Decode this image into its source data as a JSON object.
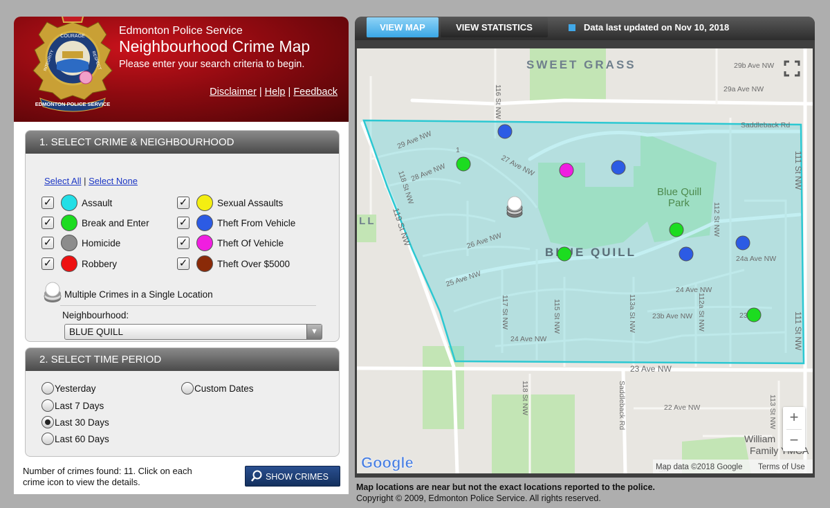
{
  "header": {
    "org": "Edmonton Police Service",
    "title": "Neighbourhood Crime Map",
    "prompt": "Please enter your search criteria to begin.",
    "links": {
      "disclaimer": "Disclaimer",
      "help": "Help",
      "feedback": "Feedback",
      "sep": "|"
    },
    "crest_text": {
      "top": "COURAGE",
      "left": "INTEGRITY",
      "right": "RESPECT",
      "banner": "EDMONTON POLICE SERVICE"
    }
  },
  "section1": {
    "title": "1. SELECT CRIME & NEIGHBOURHOOD",
    "select_all": "Select All",
    "select_none": "Select None",
    "sep": "|",
    "crimes": [
      {
        "label": "Assault",
        "color": "#22dfe6",
        "checked": true
      },
      {
        "label": "Break and Enter",
        "color": "#1cdc20",
        "checked": true
      },
      {
        "label": "Homicide",
        "color": "#8c8c8c",
        "checked": true
      },
      {
        "label": "Robbery",
        "color": "#ee1111",
        "checked": true
      },
      {
        "label": "Sexual Assaults",
        "color": "#f4ee12",
        "checked": true
      },
      {
        "label": "Theft From Vehicle",
        "color": "#2c5be4",
        "checked": true
      },
      {
        "label": "Theft Of Vehicle",
        "color": "#f01ee0",
        "checked": true
      },
      {
        "label": "Theft Over $5000",
        "color": "#8a2a08",
        "checked": true
      }
    ],
    "multi_label": "Multiple Crimes in a Single Location",
    "neighbourhood_label": "Neighbourhood:",
    "neighbourhood_value": "BLUE QUILL"
  },
  "section2": {
    "title": "2. SELECT TIME PERIOD",
    "options": [
      {
        "label": "Yesterday",
        "selected": false
      },
      {
        "label": "Last 7 Days",
        "selected": false
      },
      {
        "label": "Last 30 Days",
        "selected": true
      },
      {
        "label": "Last 60 Days",
        "selected": false
      },
      {
        "label": "Custom Dates",
        "selected": false
      }
    ]
  },
  "results": {
    "count_text": "Number of crimes found: 11. Click on each crime icon to view the details.",
    "show_button": "SHOW CRIMES"
  },
  "tabs": {
    "map": "VIEW MAP",
    "stats": "VIEW STATISTICS"
  },
  "updated_text": "Data last updated on Nov 10, 2018",
  "map": {
    "area_labels": {
      "north": "SWEET GRASS",
      "main": "BLUE QUILL",
      "park_line1": "Blue Quill",
      "park_line2": "Park",
      "west_partial": "ILL"
    },
    "streets": [
      "29b Ave NW",
      "29a Ave NW",
      "Saddleback Rd",
      "29 Ave NW",
      "28 Ave NW",
      "27 Ave NW",
      "26 Ave NW",
      "25 Ave NW",
      "24a Ave NW",
      "24 Ave NW",
      "23b Ave NW",
      "23 Ave NW",
      "22 Ave NW",
      "116 St NW",
      "118 St NW",
      "119 St NW",
      "117 St NW",
      "115 St NW",
      "113a St NW",
      "112a St NW",
      "112 St NW",
      "111 St NW",
      "113 St NW",
      "118 St NW",
      "Saddleback Rd",
      "24 Ave NW",
      "Sk",
      "23b",
      "1",
      "1",
      "1"
    ],
    "ymca_label_line1": "William",
    "ymca_label_line2": "Family YMCA",
    "google_logo": "Google",
    "map_data": "Map data ©2018 Google",
    "terms": "Terms of Use",
    "zoom_in": "+",
    "zoom_out": "−",
    "markers": [
      {
        "type": "Theft From Vehicle",
        "color": "#2c5be4"
      },
      {
        "type": "Break and Enter",
        "color": "#1cdc20"
      },
      {
        "type": "Theft Of Vehicle",
        "color": "#f01ee0"
      },
      {
        "type": "Theft From Vehicle",
        "color": "#2c5be4"
      },
      {
        "type": "Multiple Crimes",
        "color": "#ffffff"
      },
      {
        "type": "Break and Enter",
        "color": "#1cdc20"
      },
      {
        "type": "Break and Enter",
        "color": "#1cdc20"
      },
      {
        "type": "Theft From Vehicle",
        "color": "#2c5be4"
      },
      {
        "type": "Theft From Vehicle",
        "color": "#2c5be4"
      },
      {
        "type": "Break and Enter",
        "color": "#1cdc20"
      }
    ]
  },
  "footer": {
    "notice": "Map locations are near but not the exact locations reported to the police.",
    "copyright": "Copyright © 2009, Edmonton Police Service. All rights reserved."
  }
}
